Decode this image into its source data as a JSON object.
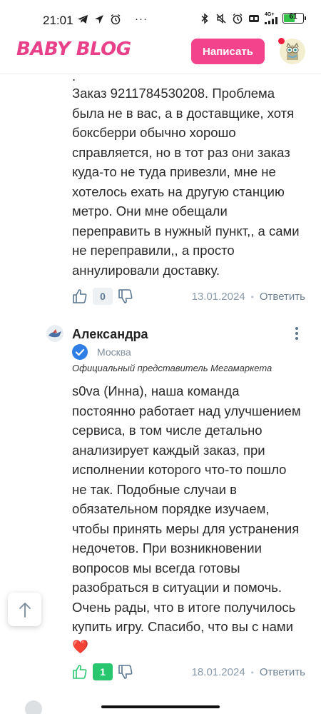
{
  "status_bar": {
    "time": "21:01",
    "ellipsis": "···",
    "network_label": "4G+",
    "battery_level": "61",
    "battery_fraction": 0.61,
    "icons": [
      "telegram-icon",
      "location-icon",
      "alarm-icon",
      "bluetooth-icon",
      "mute-icon",
      "alarm-icon",
      "volte-icon",
      "signal-icon",
      "battery-icon"
    ]
  },
  "header": {
    "logo": "BABY BLOG",
    "write_button": "Написать",
    "notification_color": "#f01d3e",
    "brand_color": "#f2438c"
  },
  "comment1": {
    "lead_dot": ".",
    "lines": [
      "Заказ 9211784530208. Проблема",
      "была не в вас, а в доставщике, хотя",
      "боксберри обычно хорошо",
      "справляется, но в тот раз они заказ",
      "куда-то не туда привезли, мне не",
      "хотелось ехать на другую станцию",
      "метро. Они мне обещали",
      "переправить в нужный пункт,, а сами",
      "не переправили,, а просто",
      "аннулировали доставку."
    ],
    "likes": "0",
    "date": "13.01.2024",
    "separator": "•",
    "reply": "Ответить"
  },
  "comment2": {
    "author": "Александра",
    "city": "Москва",
    "official": "Официальный представитель Мегамаркета",
    "lines": [
      "s0va (Инна), наша команда",
      "постоянно работает над улучшением",
      "сервиса, в том числе детально",
      "анализирует каждый заказ, при",
      "исполнении которого что-то пошло",
      "не так. Подобные случаи в",
      "обязательном порядке изучаем,",
      "чтобы принять меры для устранения",
      "недочетов. При возникновении",
      "вопросов мы всегда готовы",
      "разобраться в ситуации и помочь.",
      "Очень рады, что в итоге получилось",
      "купить игру. Спасибо, что вы с нами"
    ],
    "emoji": "❤️",
    "likes": "1",
    "date": "18.01.2024",
    "separator": "•",
    "reply": "Ответить",
    "verified_color": "#2f7ee6",
    "like_color": "#28c76f"
  }
}
